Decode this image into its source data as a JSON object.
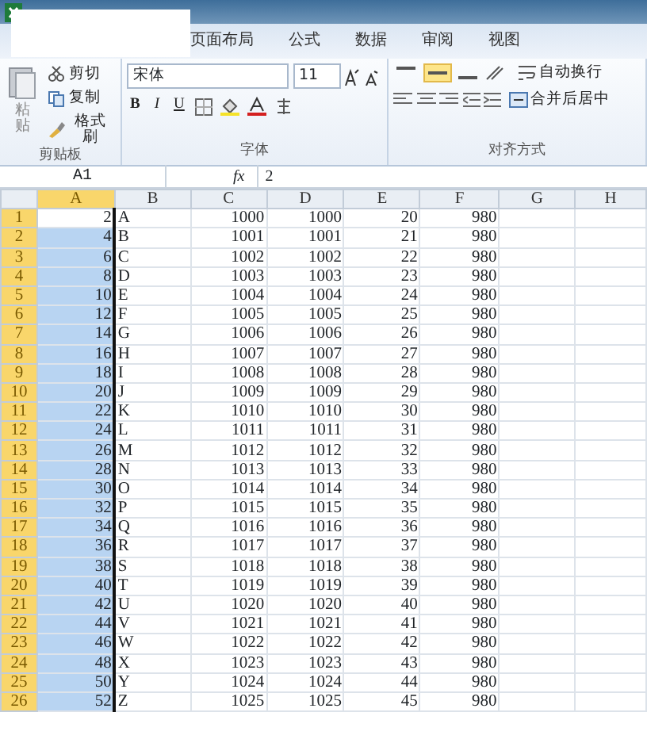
{
  "tabs": [
    {
      "label": "页面布局"
    },
    {
      "label": "公式"
    },
    {
      "label": "数据"
    },
    {
      "label": "审阅"
    },
    {
      "label": "视图"
    }
  ],
  "ribbon": {
    "clipboard": {
      "paste": "粘贴",
      "cut": "剪切",
      "copy": "复制",
      "format_painter": "格式刷",
      "group_label": "剪贴板"
    },
    "font": {
      "font_name": "宋体",
      "font_size": "11",
      "bold": "B",
      "italic": "I",
      "underline": "U",
      "group_label": "字体"
    },
    "alignment": {
      "vertical_align": [
        {
          "selected": false
        },
        {
          "selected": true
        },
        {
          "selected": false
        }
      ],
      "wrap_text": "自动换行",
      "merge_center": "合并后居中",
      "group_label": "对齐方式"
    }
  },
  "formula_bar": {
    "name_box": "A1",
    "function_label": "fx",
    "value": "2"
  },
  "columns": [
    {
      "label": "A",
      "selected": true
    },
    {
      "label": "B",
      "selected": false
    },
    {
      "label": "C",
      "selected": false
    },
    {
      "label": "D",
      "selected": false
    },
    {
      "label": "E",
      "selected": false
    },
    {
      "label": "F",
      "selected": false
    },
    {
      "label": "G",
      "selected": false
    },
    {
      "label": "H",
      "selected": false
    }
  ],
  "rows": [
    {
      "header": "1",
      "selected": true,
      "active": true,
      "cells": [
        "2",
        "A",
        "1000",
        "1000",
        "20",
        "980"
      ]
    },
    {
      "header": "2",
      "selected": true,
      "active": false,
      "cells": [
        "4",
        "B",
        "1001",
        "1001",
        "21",
        "980"
      ]
    },
    {
      "header": "3",
      "selected": true,
      "active": false,
      "cells": [
        "6",
        "C",
        "1002",
        "1002",
        "22",
        "980"
      ]
    },
    {
      "header": "4",
      "selected": true,
      "active": false,
      "cells": [
        "8",
        "D",
        "1003",
        "1003",
        "23",
        "980"
      ]
    },
    {
      "header": "5",
      "selected": true,
      "active": false,
      "cells": [
        "10",
        "E",
        "1004",
        "1004",
        "24",
        "980"
      ]
    },
    {
      "header": "6",
      "selected": true,
      "active": false,
      "cells": [
        "12",
        "F",
        "1005",
        "1005",
        "25",
        "980"
      ]
    },
    {
      "header": "7",
      "selected": true,
      "active": false,
      "cells": [
        "14",
        "G",
        "1006",
        "1006",
        "26",
        "980"
      ]
    },
    {
      "header": "8",
      "selected": true,
      "active": false,
      "cells": [
        "16",
        "H",
        "1007",
        "1007",
        "27",
        "980"
      ]
    },
    {
      "header": "9",
      "selected": true,
      "active": false,
      "cells": [
        "18",
        "I",
        "1008",
        "1008",
        "28",
        "980"
      ]
    },
    {
      "header": "10",
      "selected": true,
      "active": false,
      "cells": [
        "20",
        "J",
        "1009",
        "1009",
        "29",
        "980"
      ]
    },
    {
      "header": "11",
      "selected": true,
      "active": false,
      "cells": [
        "22",
        "K",
        "1010",
        "1010",
        "30",
        "980"
      ]
    },
    {
      "header": "12",
      "selected": true,
      "active": false,
      "cells": [
        "24",
        "L",
        "1011",
        "1011",
        "31",
        "980"
      ]
    },
    {
      "header": "13",
      "selected": true,
      "active": false,
      "cells": [
        "26",
        "M",
        "1012",
        "1012",
        "32",
        "980"
      ]
    },
    {
      "header": "14",
      "selected": true,
      "active": false,
      "cells": [
        "28",
        "N",
        "1013",
        "1013",
        "33",
        "980"
      ]
    },
    {
      "header": "15",
      "selected": true,
      "active": false,
      "cells": [
        "30",
        "O",
        "1014",
        "1014",
        "34",
        "980"
      ]
    },
    {
      "header": "16",
      "selected": true,
      "active": false,
      "cells": [
        "32",
        "P",
        "1015",
        "1015",
        "35",
        "980"
      ]
    },
    {
      "header": "17",
      "selected": true,
      "active": false,
      "cells": [
        "34",
        "Q",
        "1016",
        "1016",
        "36",
        "980"
      ]
    },
    {
      "header": "18",
      "selected": true,
      "active": false,
      "cells": [
        "36",
        "R",
        "1017",
        "1017",
        "37",
        "980"
      ]
    },
    {
      "header": "19",
      "selected": true,
      "active": false,
      "cells": [
        "38",
        "S",
        "1018",
        "1018",
        "38",
        "980"
      ]
    },
    {
      "header": "20",
      "selected": true,
      "active": false,
      "cells": [
        "40",
        "T",
        "1019",
        "1019",
        "39",
        "980"
      ]
    },
    {
      "header": "21",
      "selected": true,
      "active": false,
      "cells": [
        "42",
        "U",
        "1020",
        "1020",
        "40",
        "980"
      ]
    },
    {
      "header": "22",
      "selected": true,
      "active": false,
      "cells": [
        "44",
        "V",
        "1021",
        "1021",
        "41",
        "980"
      ]
    },
    {
      "header": "23",
      "selected": true,
      "active": false,
      "cells": [
        "46",
        "W",
        "1022",
        "1022",
        "42",
        "980"
      ]
    },
    {
      "header": "24",
      "selected": true,
      "active": false,
      "cells": [
        "48",
        "X",
        "1023",
        "1023",
        "43",
        "980"
      ]
    },
    {
      "header": "25",
      "selected": true,
      "active": false,
      "cells": [
        "50",
        "Y",
        "1024",
        "1024",
        "44",
        "980"
      ]
    },
    {
      "header": "26",
      "selected": true,
      "active": false,
      "cells": [
        "52",
        "Z",
        "1025",
        "1025",
        "45",
        "980"
      ]
    }
  ]
}
